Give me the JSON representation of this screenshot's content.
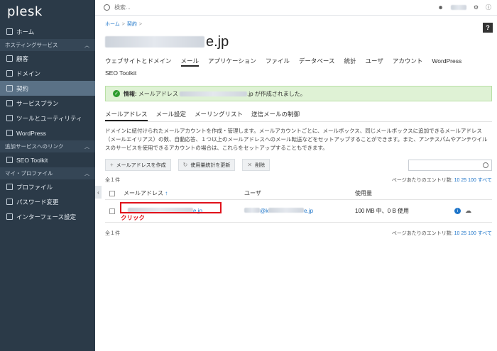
{
  "app": {
    "logo": "plesk"
  },
  "topbar": {
    "search_placeholder": "検索...",
    "user_icon": "user-icon",
    "help": "?"
  },
  "sidebar": {
    "items": [
      {
        "label": "ホーム",
        "icon": "home-icon",
        "type": "item"
      },
      {
        "label": "ホスティングサービス",
        "type": "section"
      },
      {
        "label": "顧客",
        "icon": "customers-icon",
        "type": "item"
      },
      {
        "label": "ドメイン",
        "icon": "monitor-icon",
        "type": "item"
      },
      {
        "label": "契約",
        "icon": "grid-icon",
        "type": "item",
        "active": true
      },
      {
        "label": "サービスプラン",
        "icon": "plan-icon",
        "type": "item"
      },
      {
        "label": "ツールとユーティリティ",
        "icon": "tools-icon",
        "type": "item"
      },
      {
        "label": "WordPress",
        "icon": "wordpress-icon",
        "type": "item"
      },
      {
        "label": "追加サービスへのリンク",
        "type": "section"
      },
      {
        "label": "SEO Toolkit",
        "icon": "seo-icon",
        "type": "item"
      },
      {
        "label": "マイ・プロファイル",
        "type": "section"
      },
      {
        "label": "プロファイル",
        "icon": "profile-icon",
        "type": "item"
      },
      {
        "label": "パスワード変更",
        "icon": "key-icon",
        "type": "item"
      },
      {
        "label": "インターフェース設定",
        "icon": "settings-icon",
        "type": "item"
      }
    ]
  },
  "breadcrumb": {
    "home": "ホーム",
    "sep": ">",
    "contract": "契約",
    "sep2": ">"
  },
  "page": {
    "title_suffix": "e.jp"
  },
  "tabs": [
    "ウェブサイトとドメイン",
    "メール",
    "アプリケーション",
    "ファイル",
    "データベース",
    "統計",
    "ユーザ",
    "アカウント",
    "WordPress",
    "SEO Toolkit"
  ],
  "alert": {
    "prefix": "情報:",
    "text_before": "メールアドレス",
    "text_after": ".jp が作成されました。"
  },
  "subtabs": [
    "メールアドレス",
    "メール設定",
    "メーリングリスト",
    "送信メールの制御"
  ],
  "description": "ドメインに紐付けられたメールアカウントを作成・管理します。メールアカウントごとに、メールボックス、同じメールボックスに追加できるメールアドレス（メールエイリアス）の数、自動応答、１つ以上のメールアドレスへのメール転送などをセットアップすることができます。また、アンチスパムやアンチウイルスのサービスを使用できるアカウントの場合は、これらをセットアップすることもできます。",
  "toolbar": {
    "create": "メールアドレスを作成",
    "update": "使用量統計を更新",
    "delete": "削除"
  },
  "list": {
    "count": "全１件",
    "per_page_label": "ページあたりのエントリ数:",
    "per_page": [
      "10",
      "25",
      "100",
      "すべて"
    ],
    "columns": {
      "address": "メールアドレス",
      "sort": "↑",
      "user": "ユーザ",
      "usage": "使用量"
    },
    "row": {
      "address_suffix": "e.jp",
      "user_mid": "@k",
      "user_suffix": "e.jp",
      "usage": "100 MB 中、0 B 使用"
    }
  },
  "annotation": {
    "click_label": "クリック"
  },
  "colors": {
    "sidebar": "#2b3a48",
    "link": "#1e75c9",
    "highlight": "#e0101a",
    "success_bg": "#dff2d5"
  }
}
